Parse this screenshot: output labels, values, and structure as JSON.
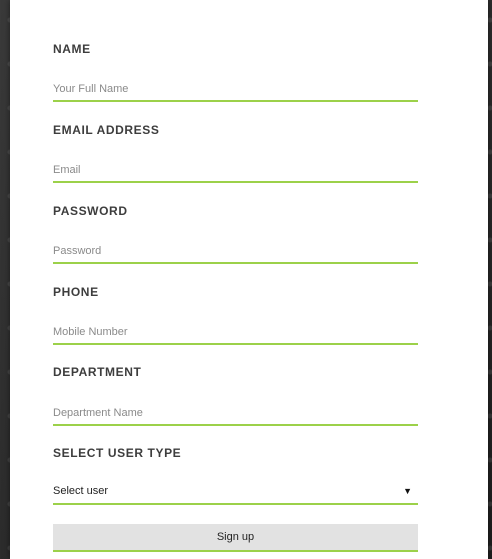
{
  "form": {
    "name": {
      "label": "NAME",
      "placeholder": "Your Full Name"
    },
    "email": {
      "label": "EMAIL ADDRESS",
      "placeholder": "Email"
    },
    "password": {
      "label": "PASSWORD",
      "placeholder": "Password"
    },
    "phone": {
      "label": "PHONE",
      "placeholder": "Mobile Number"
    },
    "department": {
      "label": "DEPARTMENT",
      "placeholder": "Department Name"
    },
    "user_type": {
      "label": "SELECT USER TYPE",
      "selected": "Select user",
      "arrow_icon": "▼"
    },
    "submit_label": "Sign up"
  },
  "colors": {
    "accent": "#9cd14a",
    "button_bg": "#e2e2e2",
    "label_text": "#3d3d3d",
    "placeholder_text": "#8a8a8a"
  }
}
